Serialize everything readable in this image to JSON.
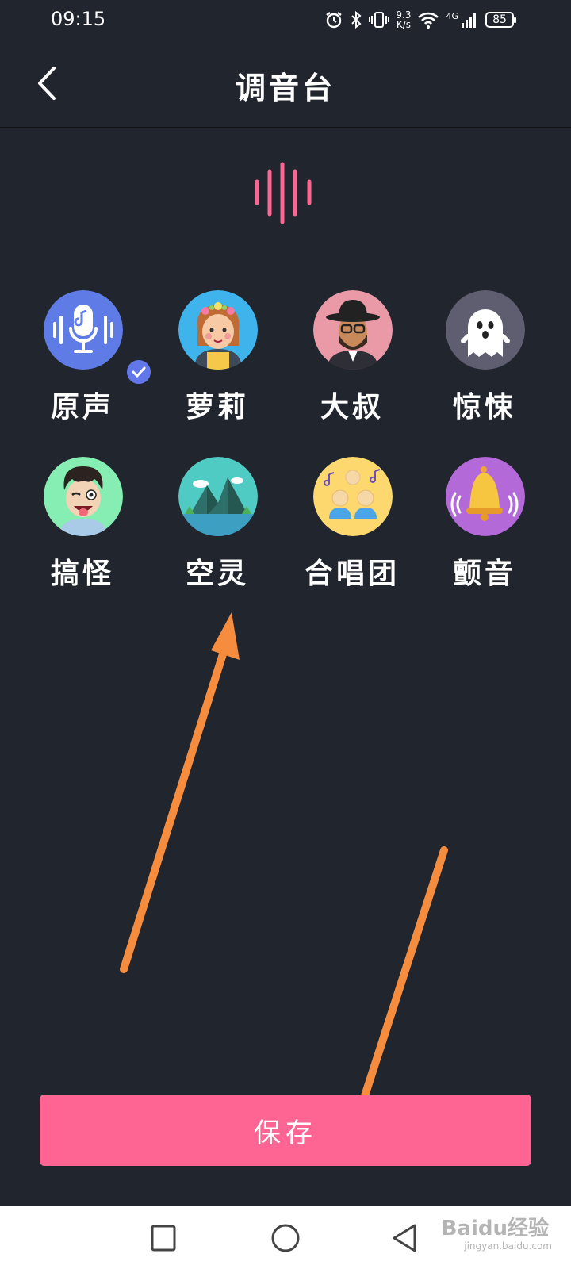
{
  "status_bar": {
    "time": "09:15",
    "net_speed_value": "9.3",
    "net_speed_unit": "K/s",
    "network_type": "4G",
    "battery": "85",
    "icons": [
      "alarm-icon",
      "bluetooth-icon",
      "vibrate-icon",
      "wifi-icon",
      "signal-icon",
      "battery-icon"
    ]
  },
  "header": {
    "title": "调音台",
    "back_icon": "chevron-left-icon"
  },
  "effects": [
    {
      "label": "原声",
      "icon": "microphone-icon",
      "selected": true
    },
    {
      "label": "萝莉",
      "icon": "girl-avatar-icon",
      "selected": false
    },
    {
      "label": "大叔",
      "icon": "uncle-avatar-icon",
      "selected": false
    },
    {
      "label": "惊悚",
      "icon": "ghost-icon",
      "selected": false
    },
    {
      "label": "搞怪",
      "icon": "funny-face-icon",
      "selected": false
    },
    {
      "label": "空灵",
      "icon": "mountain-icon",
      "selected": false
    },
    {
      "label": "合唱团",
      "icon": "choir-icon",
      "selected": false
    },
    {
      "label": "颤音",
      "icon": "bell-icon",
      "selected": false
    }
  ],
  "save_button": {
    "label": "保存"
  },
  "nav_bar": {
    "icons": [
      "recent-apps-icon",
      "home-icon",
      "back-triangle-icon"
    ]
  },
  "watermark": {
    "text": "Baidu经验",
    "sub": "jingyan.baidu.com"
  },
  "colors": {
    "background": "#21252e",
    "accent": "#ff6592",
    "selected_badge": "#6278ea",
    "annotation_arrow": "#f68c3e"
  }
}
